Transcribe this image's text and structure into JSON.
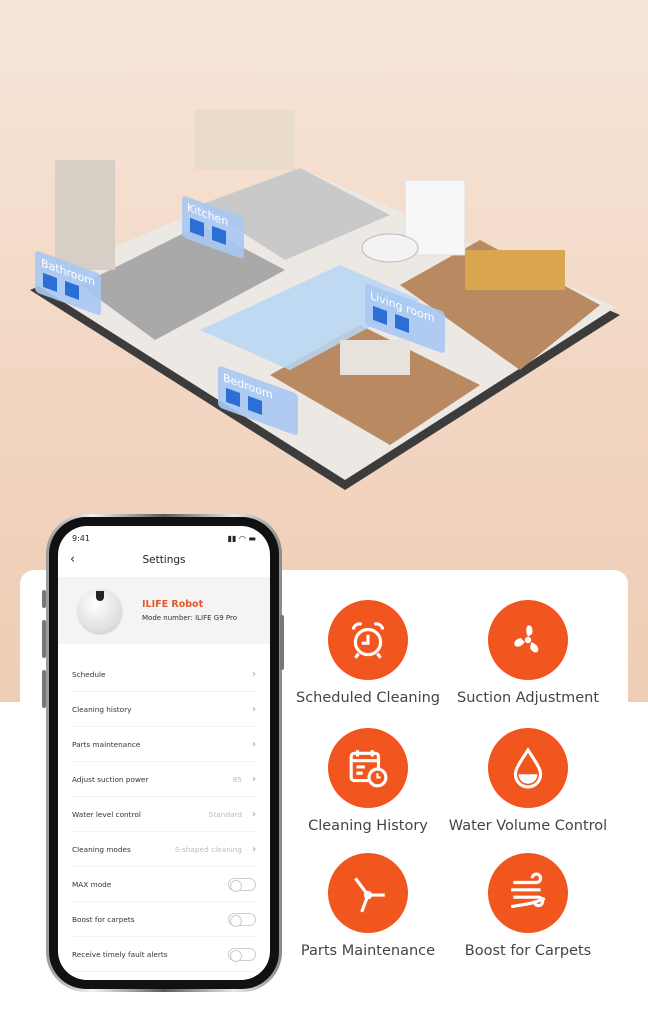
{
  "floor_plan": {
    "rooms": [
      {
        "label": "Bathroom"
      },
      {
        "label": "Kitchen"
      },
      {
        "label": "Living room"
      },
      {
        "label": "Bedroom"
      }
    ]
  },
  "phone": {
    "status_time": "9:41",
    "title": "Settings",
    "robot_name": "ILIFE Robot",
    "robot_model": "Mode number: ILIFE G9 Pro",
    "rows": [
      {
        "label": "Schedule",
        "value": "",
        "type": "link"
      },
      {
        "label": "Cleaning history",
        "value": "",
        "type": "link"
      },
      {
        "label": "Parts maintenance",
        "value": "",
        "type": "link"
      },
      {
        "label": "Adjust suction power",
        "value": "85",
        "type": "link"
      },
      {
        "label": "Water level control",
        "value": "Standard",
        "type": "link"
      },
      {
        "label": "Cleaning modes",
        "value": "S-shaped cleaning",
        "type": "link"
      },
      {
        "label": "MAX mode",
        "value": "",
        "type": "toggle",
        "on": false
      },
      {
        "label": "Boost for carpets",
        "value": "",
        "type": "toggle",
        "on": false
      },
      {
        "label": "Receive timely fault alerts",
        "value": "",
        "type": "toggle",
        "on": false
      }
    ]
  },
  "features": [
    {
      "label": "Scheduled Cleaning",
      "icon": "alarm-clock-icon"
    },
    {
      "label": "Suction Adjustment",
      "icon": "fan-icon"
    },
    {
      "label": "Cleaning History",
      "icon": "calendar-clock-icon"
    },
    {
      "label": "Water Volume Control",
      "icon": "water-drop-icon"
    },
    {
      "label": "Parts Maintenance",
      "icon": "side-brush-icon"
    },
    {
      "label": "Boost for Carpets",
      "icon": "wind-boost-icon"
    }
  ],
  "colors": {
    "accent": "#F0561E",
    "label_panel": "#a9c8f2"
  }
}
